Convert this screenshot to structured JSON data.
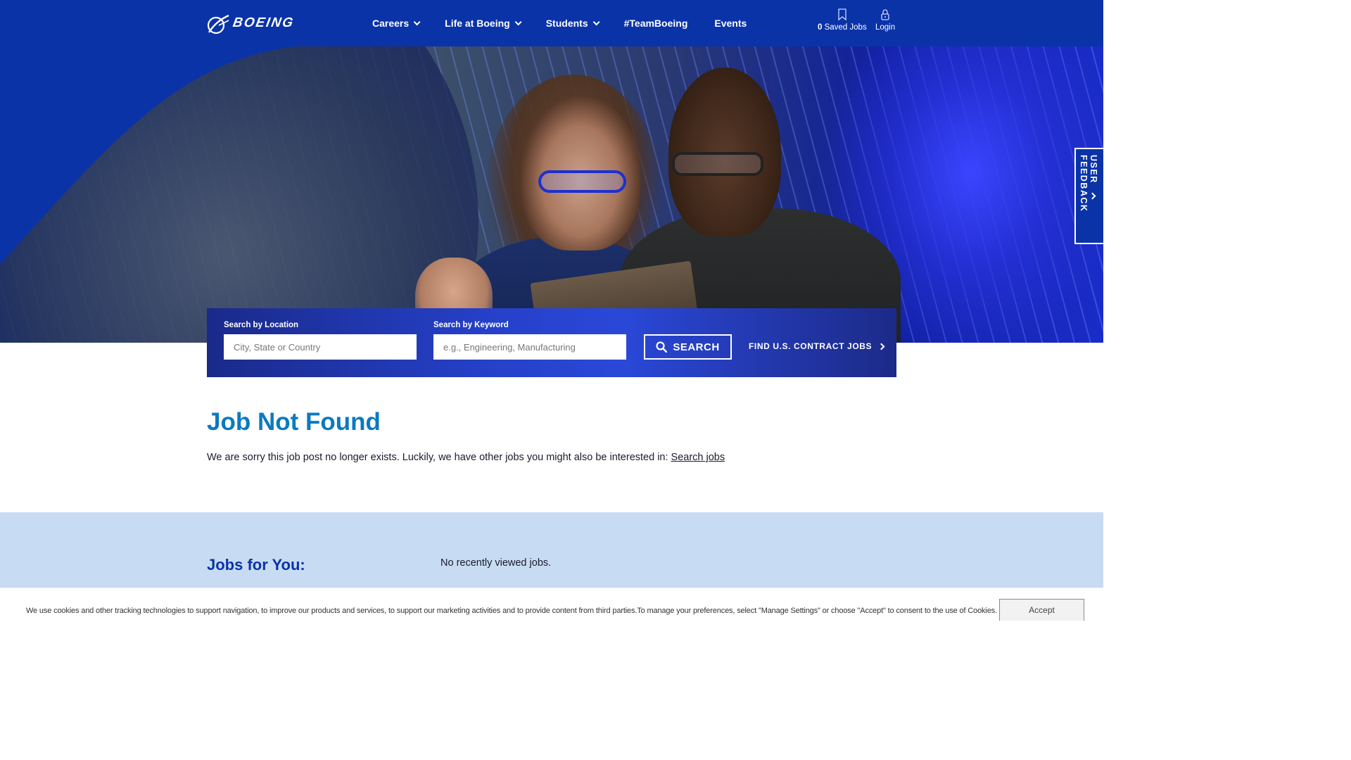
{
  "header": {
    "logo_text": "BOEING",
    "nav": [
      {
        "label": "Careers",
        "dropdown": true
      },
      {
        "label": "Life at Boeing",
        "dropdown": true
      },
      {
        "label": "Students",
        "dropdown": true
      },
      {
        "label": "#TeamBoeing",
        "dropdown": false
      },
      {
        "label": "Events",
        "dropdown": false
      }
    ],
    "saved_jobs": {
      "count": "0",
      "label": "Saved Jobs",
      "icon": "bookmark-icon"
    },
    "login": {
      "label": "Login",
      "icon": "lock-icon"
    }
  },
  "feedback_tab": {
    "label": "USER FEEDBACK"
  },
  "search": {
    "location_label": "Search by Location",
    "location_placeholder": "City, State or Country",
    "keyword_label": "Search by Keyword",
    "keyword_placeholder": "e.g., Engineering, Manufacturing",
    "button_label": "SEARCH",
    "contract_link": "FIND U.S. CONTRACT JOBS"
  },
  "main": {
    "title": "Job Not Found",
    "message": "We are sorry this job post no longer exists. Luckily, we have other jobs you might also be interested in: ",
    "link": "Search jobs"
  },
  "jobs_for_you": {
    "title": "Jobs for You:",
    "empty": "No recently viewed jobs."
  },
  "cookie": {
    "text": "We use cookies and other tracking technologies to support navigation, to improve our products and services, to support our marketing activities and to provide content from third parties.To manage your preferences, select \"Manage Settings\" or choose \"Accept\" to consent to the use of Cookies.",
    "accept_label": "Accept"
  },
  "colors": {
    "brand_blue": "#0a33a8",
    "title_blue": "#0b7ac0",
    "jobs_bg": "#c7dcf2"
  }
}
